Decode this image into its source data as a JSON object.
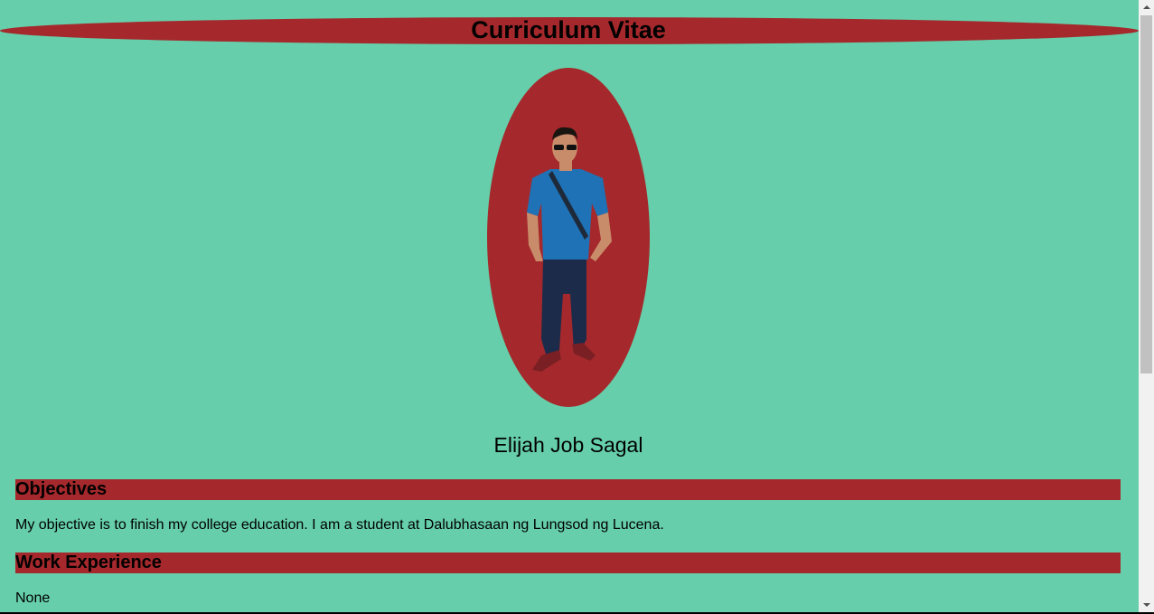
{
  "header": {
    "title": "Curriculum Vitae"
  },
  "profile": {
    "name": "Elijah Job Sagal",
    "photo_icon": "person-photo"
  },
  "sections": {
    "objectives": {
      "heading": "Objectives",
      "text": "My objective is to finish my college education. I am a student at Dalubhasaan ng Lungsod ng Lucena."
    },
    "work": {
      "heading": "Work Experience",
      "text": "None"
    }
  },
  "colors": {
    "background": "#66ceaa",
    "accent": "#a5292c"
  }
}
